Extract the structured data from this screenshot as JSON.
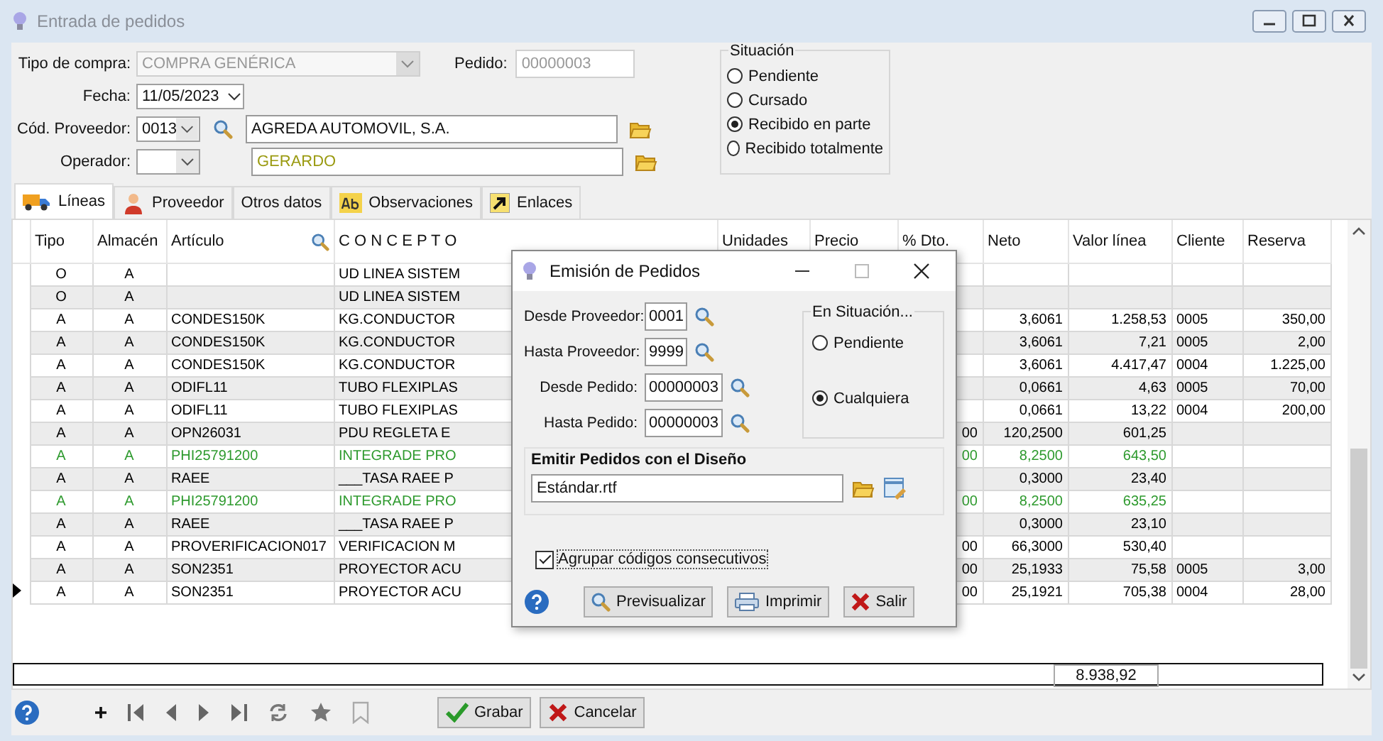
{
  "window": {
    "title": "Entrada de pedidos"
  },
  "form": {
    "purchase_type": {
      "label": "Tipo de compra:",
      "value": "COMPRA GENÉRICA",
      "disabled": true
    },
    "order": {
      "label": "Pedido:",
      "value": "00000003",
      "disabled": true
    },
    "date": {
      "label": "Fecha:",
      "value": "11/05/2023"
    },
    "supplier": {
      "label": "Cód. Proveedor:",
      "code": "0013",
      "name": "AGREDA AUTOMOVIL, S.A."
    },
    "operator": {
      "label": "Operador:",
      "name": "GERARDO"
    },
    "status": {
      "title": "Situación",
      "options": [
        {
          "label": "Pendiente",
          "selected": false
        },
        {
          "label": "Cursado",
          "selected": false
        },
        {
          "label": "Recibido en parte",
          "selected": true
        },
        {
          "label": "Recibido totalmente",
          "selected": false
        }
      ]
    }
  },
  "tabs": [
    {
      "label": "Líneas",
      "kind": "truck",
      "selected": true
    },
    {
      "label": "Proveedor",
      "kind": "person",
      "selected": false
    },
    {
      "label": "Otros datos",
      "kind": "none",
      "selected": false
    },
    {
      "label": "Observaciones",
      "kind": "note",
      "selected": false
    },
    {
      "label": "Enlaces",
      "kind": "link",
      "selected": false
    }
  ],
  "table": {
    "columns": [
      "Tipo",
      "Almacén",
      "Artículo",
      "C O N C E P T O",
      "Unidades",
      "Precio",
      "% Dto.",
      "Neto",
      "Valor línea",
      "Cliente",
      "Reserva"
    ],
    "rows": [
      {
        "tipo": "O",
        "almacen": "A",
        "concepto": "UD LINEA SISTEM",
        "color": "#000000",
        "current": false
      },
      {
        "tipo": "O",
        "almacen": "A",
        "concepto": "UD LINEA SISTEM",
        "color": "#000000",
        "current": false
      },
      {
        "tipo": "A",
        "almacen": "A",
        "articulo": "CONDES150K",
        "concepto": "KG.CONDUCTOR",
        "neto": "3,6061",
        "valor": "1.258,53",
        "cliente": "0005",
        "reserva": "350,00",
        "color": "#000000",
        "current": false
      },
      {
        "tipo": "A",
        "almacen": "A",
        "articulo": "CONDES150K",
        "concepto": "KG.CONDUCTOR",
        "neto": "3,6061",
        "valor": "7,21",
        "cliente": "0005",
        "reserva": "2,00",
        "color": "#000000",
        "current": false
      },
      {
        "tipo": "A",
        "almacen": "A",
        "articulo": "CONDES150K",
        "concepto": "KG.CONDUCTOR",
        "neto": "3,6061",
        "valor": "4.417,47",
        "cliente": "0004",
        "reserva": "1.225,00",
        "color": "#000000",
        "current": false
      },
      {
        "tipo": "A",
        "almacen": "A",
        "articulo": "ODIFL11",
        "concepto": "TUBO FLEXIPLAS",
        "neto": "0,0661",
        "valor": "4,63",
        "cliente": "0005",
        "reserva": "70,00",
        "color": "#000000",
        "current": false
      },
      {
        "tipo": "A",
        "almacen": "A",
        "articulo": "ODIFL11",
        "concepto": "TUBO FLEXIPLAS",
        "neto": "0,0661",
        "valor": "13,22",
        "cliente": "0004",
        "reserva": "200,00",
        "color": "#000000",
        "current": false
      },
      {
        "tipo": "A",
        "almacen": "A",
        "articulo": "OPN26031",
        "concepto": "PDU REGLETA E",
        "dto": "00",
        "neto": "120,2500",
        "valor": "601,25",
        "color": "#000000",
        "current": false
      },
      {
        "tipo": "A",
        "almacen": "A",
        "articulo": "PHI25791200",
        "concepto": "INTEGRADE PRO",
        "dto": "00",
        "neto": "8,2500",
        "valor": "643,50",
        "color": "#2e9a2e",
        "current": false
      },
      {
        "tipo": "A",
        "almacen": "A",
        "articulo": "RAEE",
        "concepto": "___TASA RAEE P",
        "neto": "0,3000",
        "valor": "23,40",
        "color": "#000000",
        "current": false
      },
      {
        "tipo": "A",
        "almacen": "A",
        "articulo": "PHI25791200",
        "concepto": "INTEGRADE PRO",
        "dto": "00",
        "neto": "8,2500",
        "valor": "635,25",
        "color": "#2e9a2e",
        "current": false
      },
      {
        "tipo": "A",
        "almacen": "A",
        "articulo": "RAEE",
        "concepto": "___TASA RAEE P",
        "neto": "0,3000",
        "valor": "23,10",
        "color": "#000000",
        "current": false
      },
      {
        "tipo": "A",
        "almacen": "A",
        "articulo": "PROVERIFICACION017",
        "concepto": "VERIFICACION M",
        "dto": "00",
        "neto": "66,3000",
        "valor": "530,40",
        "color": "#000000",
        "current": false
      },
      {
        "tipo": "A",
        "almacen": "A",
        "articulo": "SON2351",
        "concepto": "PROYECTOR ACU",
        "dto": "00",
        "neto": "25,1933",
        "valor": "75,58",
        "cliente": "0005",
        "reserva": "3,00",
        "color": "#000000",
        "current": false
      },
      {
        "tipo": "A",
        "almacen": "A",
        "articulo": "SON2351",
        "concepto": "PROYECTOR ACU",
        "dto": "00",
        "neto": "25,1921",
        "valor": "705,38",
        "cliente": "0004",
        "reserva": "28,00",
        "color": "#000000",
        "current": true
      }
    ],
    "total": "8.938,92"
  },
  "toolbar": {
    "buttons": [
      {
        "label": "Grabar",
        "kind": "check"
      },
      {
        "label": "Cancelar",
        "kind": "cross"
      }
    ]
  },
  "dialog": {
    "title": "Emisión de Pedidos",
    "fields": [
      {
        "label": "Desde Proveedor:",
        "value": "0001"
      },
      {
        "label": "Hasta Proveedor:",
        "value": "9999"
      },
      {
        "label": "Desde Pedido:",
        "value": "00000003"
      },
      {
        "label": "Hasta Pedido:",
        "value": "00000003"
      }
    ],
    "status": {
      "title": "En Situación...",
      "options": [
        {
          "label": "Pendiente",
          "selected": false
        },
        {
          "label": "Cualquiera",
          "selected": true
        }
      ]
    },
    "design": {
      "title": "Emitir Pedidos con el Diseño",
      "value": "Estándar.rtf"
    },
    "group_codes": {
      "label": "Agrupar códigos consecutivos",
      "checked": true
    },
    "buttons": [
      {
        "label": "Previsualizar",
        "kind": "search"
      },
      {
        "label": "Imprimir",
        "kind": "print"
      },
      {
        "label": "Salir",
        "kind": "cross"
      }
    ]
  }
}
